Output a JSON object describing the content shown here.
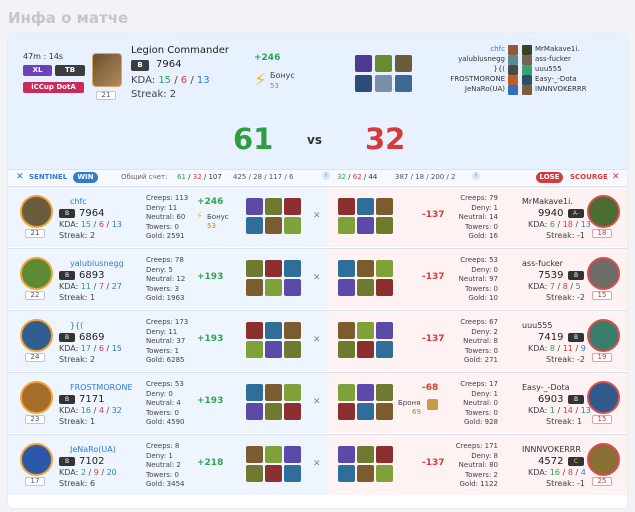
{
  "title": "Инфа о матче",
  "summary": {
    "time": "47m : 14s",
    "badge_xl": "XL",
    "badge_tb": "TB",
    "badge_mode": "iCCup DotA",
    "hero": "Legion Commander",
    "rank_letter": "B",
    "rating": "7964",
    "kda_label": "KDA:",
    "kda": {
      "kills": "15",
      "deaths": "6",
      "assists": "13"
    },
    "streak": "Streak: 2",
    "level": "21",
    "gain": "+246",
    "bonus_label": "Бонус",
    "bonus_value": "53",
    "score_sentinel": "61",
    "vs": "vs",
    "score_scourge": "32",
    "team_left": [
      "chfc",
      "yalublusnegg",
      "}{(",
      "FROSTMORONE",
      "JeNaRo(UA)"
    ],
    "team_right": [
      "MrMakave1i.",
      "ass-fucker",
      "uuu555",
      "Easy-_-Dota",
      "INNNVOKERRR"
    ]
  },
  "header": {
    "sentinel": "SENTINEL",
    "win": "WIN",
    "total_label": "Общий счет:",
    "left_kda": {
      "k": "61",
      "d": "32",
      "a": "107"
    },
    "left_extra": "425 / 28 / 117 / 6",
    "right_kda": {
      "k": "32",
      "d": "62",
      "a": "44"
    },
    "right_extra": "387 / 18 / 200 / 2",
    "lose": "LOSE",
    "scourge": "SCOURGE"
  },
  "rows": [
    {
      "left_name": "chfc",
      "left_rating": "7964",
      "left_kda": [
        "15",
        "6",
        "13"
      ],
      "left_streak": "Streak: 2",
      "left_level": "21",
      "left_stats": [
        "Creeps: 113",
        "Deny: 11",
        "Neutral: 60",
        "Towers: 0",
        "Gold: 2591"
      ],
      "left_gain": "+246",
      "left_bonus": "Бонус",
      "left_bonus_val": "53",
      "right_gain": "-137",
      "right_stats": [
        "Creeps: 79",
        "Deny: 1",
        "Neutral: 14",
        "Towers: 0",
        "Gold: 16"
      ],
      "right_name": "MrMakave1i.",
      "right_rank": "A-",
      "right_rating": "9940",
      "right_kda": [
        "6",
        "18",
        "13"
      ],
      "right_streak": "Streak: -1",
      "right_level": "18"
    },
    {
      "left_name": "yalublusnegg",
      "left_rating": "6893",
      "left_kda": [
        "11",
        "7",
        "27"
      ],
      "left_streak": "Streak: 1",
      "left_level": "22",
      "left_stats": [
        "Creeps: 78",
        "Deny: 5",
        "Neutral: 12",
        "Towers: 3",
        "Gold: 1963"
      ],
      "left_gain": "+193",
      "right_gain": "-137",
      "right_stats": [
        "Creeps: 53",
        "Deny: 0",
        "Neutral: 97",
        "Towers: 0",
        "Gold: 10"
      ],
      "right_name": "ass-fucker",
      "right_rank": "B",
      "right_rating": "7539",
      "right_kda": [
        "7",
        "8",
        "5"
      ],
      "right_streak": "Streak: -2",
      "right_level": "15"
    },
    {
      "left_name": "}{(",
      "left_rating": "6869",
      "left_kda": [
        "17",
        "6",
        "15"
      ],
      "left_streak": "Streak: 2",
      "left_level": "24",
      "left_stats": [
        "Creeps: 173",
        "Deny: 11",
        "Neutral: 37",
        "Towers: 1",
        "Gold: 6285"
      ],
      "left_gain": "+193",
      "right_gain": "-137",
      "right_stats": [
        "Creeps: 67",
        "Deny: 2",
        "Neutral: 8",
        "Towers: 0",
        "Gold: 271"
      ],
      "right_name": "uuu555",
      "right_rank": "B",
      "right_rating": "7419",
      "right_kda": [
        "8",
        "11",
        "9"
      ],
      "right_streak": "Streak: -2",
      "right_level": "19"
    },
    {
      "left_name": "FROSTMORONE",
      "left_rating": "7171",
      "left_kda": [
        "16",
        "4",
        "32"
      ],
      "left_streak": "Streak: 1",
      "left_level": "23",
      "left_stats": [
        "Creeps: 53",
        "Deny: 0",
        "Neutral: 4",
        "Towers: 0",
        "Gold: 4590"
      ],
      "left_gain": "+193",
      "right_gain": "-68",
      "right_armor": "Броня",
      "right_armor_val": "69",
      "right_stats": [
        "Creeps: 17",
        "Deny: 1",
        "Neutral: 0",
        "Towers: 0",
        "Gold: 928"
      ],
      "right_name": "Easy-_-Dota",
      "right_rank": "B",
      "right_rating": "6903",
      "right_kda": [
        "1",
        "14",
        "13"
      ],
      "right_streak": "Streak: 1",
      "right_level": "15"
    },
    {
      "left_name": "JeNaRo(UA)",
      "left_rating": "7102",
      "left_kda": [
        "2",
        "9",
        "20"
      ],
      "left_streak": "Streak: 6",
      "left_level": "17",
      "left_stats": [
        "Creeps: 8",
        "Deny: 1",
        "Neutral: 2",
        "Towers: 0",
        "Gold: 3454"
      ],
      "left_gain": "+218",
      "right_gain": "-137",
      "right_stats": [
        "Creeps: 171",
        "Deny: 8",
        "Neutral: 80",
        "Towers: 2",
        "Gold: 1122"
      ],
      "right_name": "INNNVOKERRR",
      "right_rank": "C",
      "right_rating": "4572",
      "right_kda": [
        "16",
        "8",
        "4"
      ],
      "right_streak": "Streak: -1",
      "right_level": "25"
    }
  ]
}
